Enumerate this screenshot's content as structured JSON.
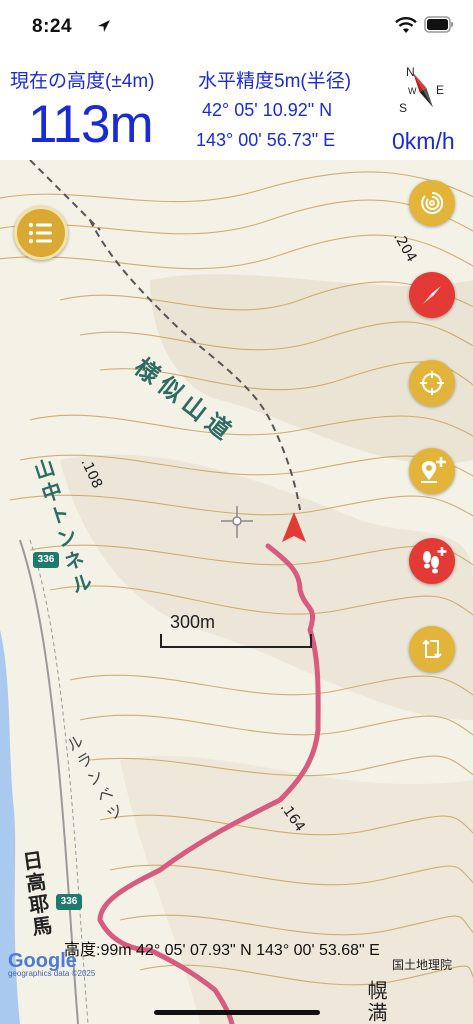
{
  "status_bar": {
    "time": "8:24"
  },
  "header": {
    "altitude_label": "現在の高度(±4m)",
    "altitude_value": "113m",
    "accuracy_label": "水平精度5m(半径)",
    "latitude": "42° 05' 10.92\" N",
    "longitude": "143° 00' 56.73\" E",
    "speed": "0km/h"
  },
  "map": {
    "labels": {
      "trail_name": "様似山道",
      "tunnel_name": "山中トンネル",
      "rurandabetsu": "ルランベツ",
      "hidaka": "日高耶馬",
      "horoman": "幌満"
    },
    "elevations": {
      "e204": ".204",
      "e108": ".108",
      "e164": ".164"
    },
    "route_shields": [
      "336",
      "336"
    ],
    "scale_label": "300m",
    "cursor_info": "高度:99m  42° 05' 07.93\" N 143° 00' 53.68\" E",
    "google_logo": "Google",
    "google_sub": "geographics data ©2025",
    "credit": "国土地理院"
  },
  "colors": {
    "accent_text": "#1a2bd6",
    "gold_button": "#e2b53a",
    "red_button": "#e33a35",
    "track": "#d85a7e",
    "contour": "#c9a45c",
    "sea": "#a9c9ef"
  },
  "controls": {
    "menu": "menu-icon",
    "buttons": [
      "spiral-icon",
      "compass-needle-icon",
      "locate-icon",
      "add-place-icon",
      "add-footprint-icon",
      "rotate-icon"
    ]
  }
}
